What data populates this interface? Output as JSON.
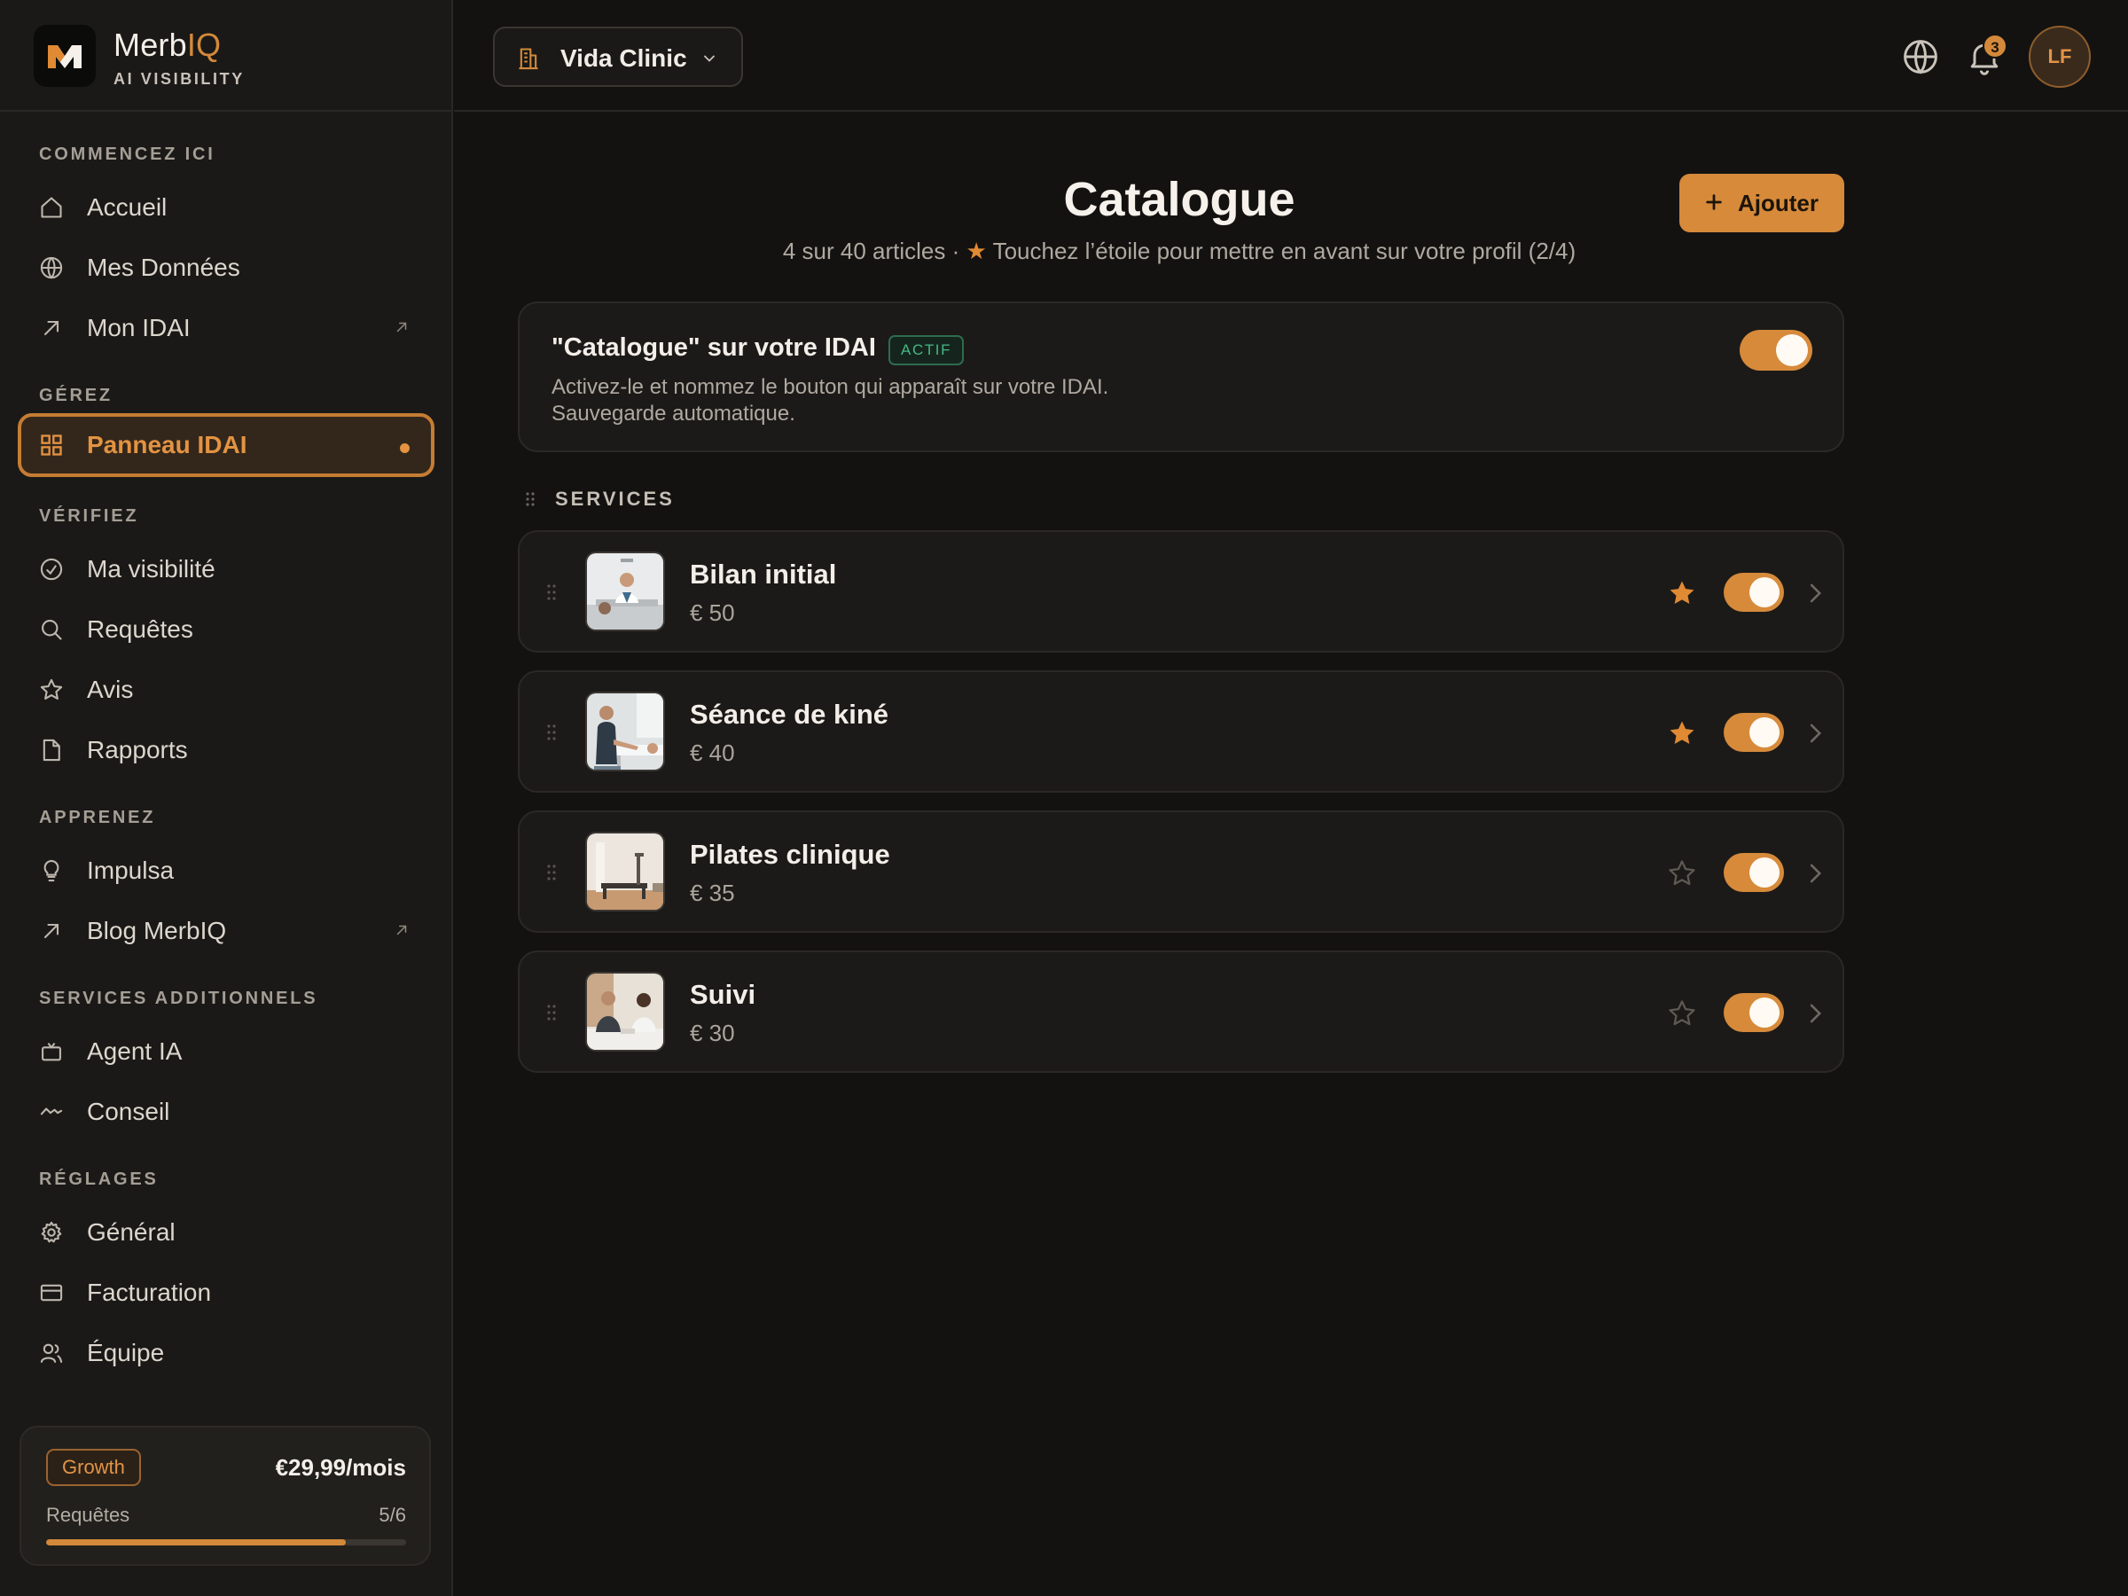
{
  "brand": {
    "name_main": "Merb",
    "name_accent": "IQ",
    "subtitle": "AI VISIBILITY"
  },
  "sidebar": {
    "sections": [
      {
        "title": "COMMENCEZ ICI"
      },
      {
        "title": "GÉREZ"
      },
      {
        "title": "VÉRIFIEZ"
      },
      {
        "title": "APPRENEZ"
      },
      {
        "title": "SERVICES ADDITIONNELS"
      },
      {
        "title": "RÉGLAGES"
      }
    ],
    "items": [
      {
        "label": "Accueil",
        "icon": "home-icon"
      },
      {
        "label": "Mes Données",
        "icon": "globe-icon"
      },
      {
        "label": "Mon IDAI",
        "icon": "arrow-up-right-icon",
        "external": true
      },
      {
        "label": "Panneau IDAI",
        "icon": "grid-icon",
        "active": true
      },
      {
        "label": "Ma visibilité",
        "icon": "gauge-icon"
      },
      {
        "label": "Requêtes",
        "icon": "search-icon"
      },
      {
        "label": "Avis",
        "icon": "star-icon"
      },
      {
        "label": "Rapports",
        "icon": "document-icon"
      },
      {
        "label": "Impulsa",
        "icon": "lightbulb-icon"
      },
      {
        "label": "Blog MerbIQ",
        "icon": "arrow-up-right-icon",
        "external": true
      },
      {
        "label": "Agent IA",
        "icon": "bot-icon"
      },
      {
        "label": "Conseil",
        "icon": "activity-icon"
      },
      {
        "label": "Général",
        "icon": "gear-icon"
      },
      {
        "label": "Facturation",
        "icon": "credit-card-icon"
      },
      {
        "label": "Équipe",
        "icon": "users-icon"
      }
    ]
  },
  "plan": {
    "badge": "Growth",
    "price": "€29,99/mois",
    "usage_label": "Requêtes",
    "usage_count": "5/6",
    "usage_fraction": 0.833
  },
  "topbar": {
    "org_name": "Vida Clinic",
    "notification_count": "3",
    "avatar_initials": "LF"
  },
  "page": {
    "title": "Catalogue",
    "subtitle_count": "4 sur 40 articles ·",
    "subtitle_star": "★",
    "subtitle_hint": "Touchez l’étoile pour mettre en avant sur votre profil (2/4)",
    "add_button": "Ajouter"
  },
  "feature": {
    "title": "\"Catalogue\" sur votre IDAI",
    "badge": "ACTIF",
    "desc_line1": "Activez-le et nommez le bouton qui apparaît sur votre IDAI.",
    "desc_line2": "Sauvegarde automatique.",
    "enabled": true
  },
  "services": {
    "section_title": "SERVICES",
    "items": [
      {
        "name": "Bilan initial",
        "price": "€ 50",
        "featured": true,
        "enabled": true
      },
      {
        "name": "Séance de kiné",
        "price": "€ 40",
        "featured": true,
        "enabled": true
      },
      {
        "name": "Pilates clinique",
        "price": "€ 35",
        "featured": false,
        "enabled": true
      },
      {
        "name": "Suivi",
        "price": "€ 30",
        "featured": false,
        "enabled": true
      }
    ]
  },
  "colors": {
    "accent": "#d68a3a",
    "background": "#131211",
    "sidebar": "#1a1917",
    "success": "#46b785"
  }
}
